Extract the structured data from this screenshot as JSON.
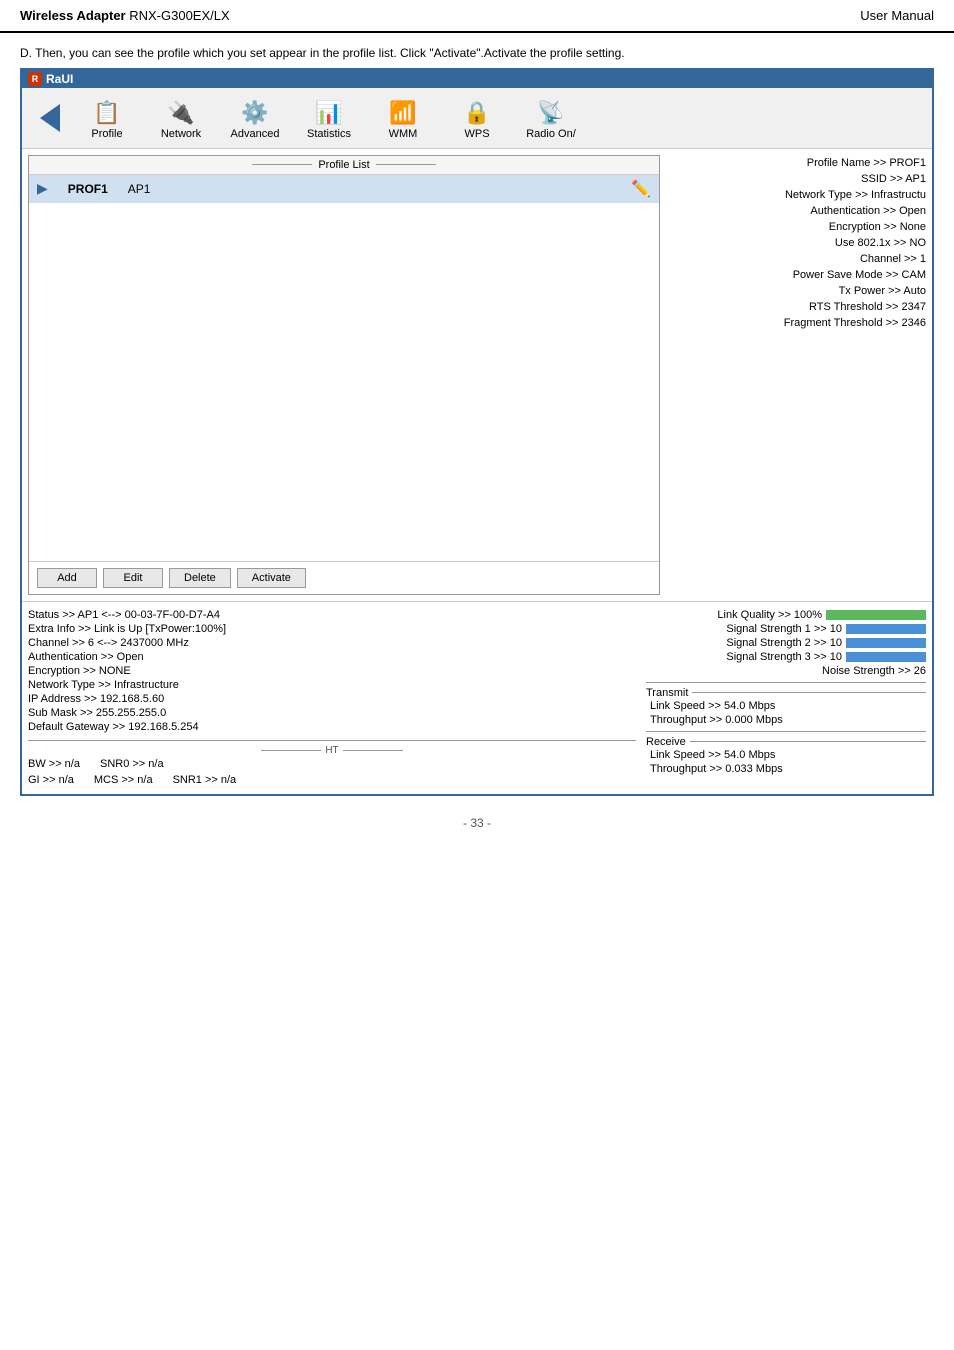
{
  "header": {
    "left": "Wireless Adapter",
    "left_bold": "Wireless Adapter",
    "model": " RNX-G300EX/LX",
    "right": "User Manual"
  },
  "top_text": "D. Then, you can see the profile which you set appear in the profile list. Click \"Activate\".Activate the profile setting.",
  "window": {
    "title": "RaUI",
    "toolbar": {
      "back_label": "",
      "items": [
        {
          "id": "profile",
          "label": "Profile",
          "icon": "📋"
        },
        {
          "id": "network",
          "label": "Network",
          "icon": "🔌"
        },
        {
          "id": "advanced",
          "label": "Advanced",
          "icon": "⚙️"
        },
        {
          "id": "statistics",
          "label": "Statistics",
          "icon": "📊"
        },
        {
          "id": "wmm",
          "label": "WMM",
          "icon": "📶"
        },
        {
          "id": "wps",
          "label": "WPS",
          "icon": "🔒"
        },
        {
          "id": "radio",
          "label": "Radio On/",
          "icon": "📡"
        }
      ]
    },
    "profile_list": {
      "header": "Profile List",
      "rows": [
        {
          "name": "PROF1",
          "ssid": "AP1",
          "active": true
        }
      ]
    },
    "profile_info": {
      "lines": [
        "Profile Name >> PROF1",
        "SSID >> AP1",
        "Network Type >> Infrastructu",
        "Authentication >> Open",
        "Encryption >> None",
        "Use 802.1x >> NO",
        "Channel >> 1",
        "Power Save Mode >> CAM",
        "Tx Power >> Auto",
        "RTS Threshold >> 2347",
        "Fragment Threshold >> 2346"
      ]
    },
    "buttons": [
      {
        "id": "add",
        "label": "Add"
      },
      {
        "id": "edit",
        "label": "Edit"
      },
      {
        "id": "delete",
        "label": "Delete"
      },
      {
        "id": "activate",
        "label": "Activate"
      }
    ],
    "status_lines": [
      "Status >> AP1 <--> 00-03-7F-00-D7-A4",
      "Extra Info >> Link is Up [TxPower:100%]",
      "Channel >> 6 <--> 2437000 MHz",
      "Authentication >> Open",
      "Encryption >> NONE",
      "Network Type >> Infrastructure",
      "IP Address >> 192.168.5.60",
      "Sub Mask >> 255.255.255.0",
      "Default Gateway >> 192.168.5.254"
    ],
    "ht_section": {
      "header": "HT",
      "rows": [
        {
          "col1": "BW >> n/a",
          "col2": "SNR0 >> n/a"
        },
        {
          "col1": "GI >> n/a",
          "col2": "MCS >> n/a",
          "col3": "SNR1 >> n/a"
        }
      ]
    },
    "signal_info": {
      "link_quality": "Link Quality >> 100%",
      "signal_strength_1": "Signal Strength 1 >> 10",
      "signal_strength_2": "Signal Strength 2 >> 10",
      "signal_strength_3": "Signal Strength 3 >> 10",
      "noise_strength": "Noise Strength >> 26"
    },
    "transmit": {
      "header": "Transmit",
      "link_speed": "Link Speed >> 54.0 Mbps",
      "throughput": "Throughput >> 0.000 Mbps"
    },
    "receive": {
      "header": "Receive",
      "link_speed": "Link Speed >> 54.0 Mbps",
      "throughput": "Throughput >> 0.033 Mbps"
    }
  },
  "footer": {
    "page": "- 33 -"
  }
}
